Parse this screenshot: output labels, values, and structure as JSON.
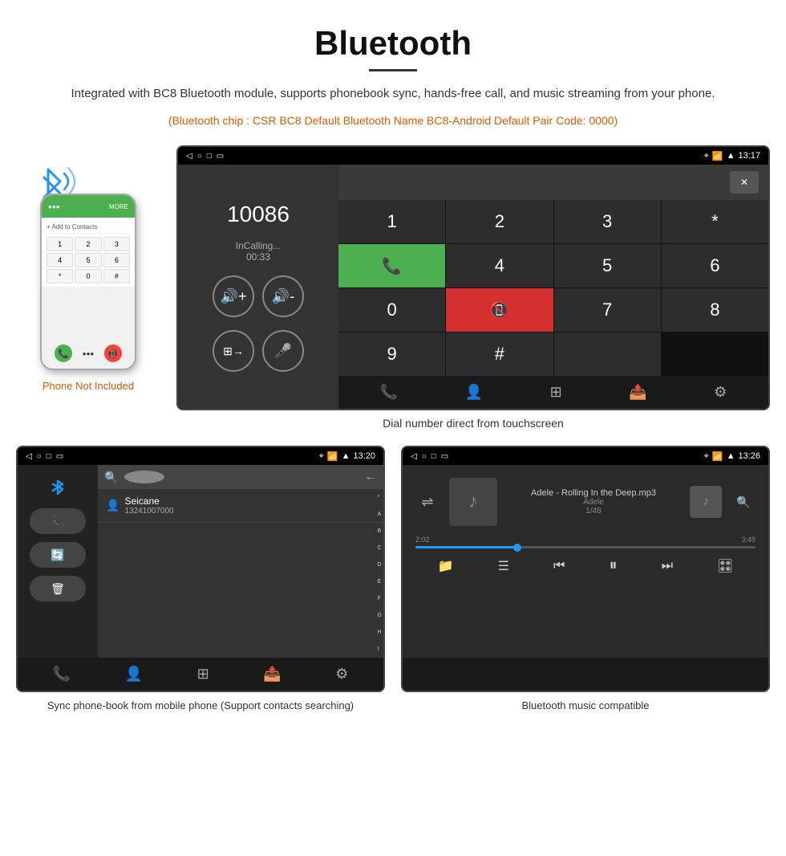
{
  "header": {
    "title": "Bluetooth",
    "description": "Integrated with BC8 Bluetooth module, supports phonebook sync, hands-free call, and music streaming from your phone.",
    "specs": "(Bluetooth chip : CSR BC8    Default Bluetooth Name BC8-Android    Default Pair Code: 0000)"
  },
  "dial_screen": {
    "number": "10086",
    "status": "InCalling...",
    "timer": "00:33",
    "time": "13:17",
    "keys": [
      "1",
      "2",
      "3",
      "*",
      "",
      "4",
      "5",
      "6",
      "0",
      "",
      "7",
      "8",
      "9",
      "#",
      ""
    ]
  },
  "phonebook_screen": {
    "time": "13:20",
    "contact_name": "Seicane",
    "contact_number": "13241007000",
    "alphabet": [
      "*",
      "A",
      "B",
      "C",
      "D",
      "E",
      "F",
      "G",
      "H",
      "I"
    ]
  },
  "music_screen": {
    "time": "13:26",
    "track": "Adele - Rolling In the Deep.mp3",
    "artist": "Adele",
    "track_info": "1/48",
    "time_current": "2:02",
    "time_total": "3:49",
    "progress_percent": 30
  },
  "captions": {
    "dial": "Dial number direct from touchscreen",
    "phonebook": "Sync phone-book from mobile phone (Support contacts searching)",
    "music": "Bluetooth music compatible"
  },
  "phone_label": "Phone Not Included"
}
